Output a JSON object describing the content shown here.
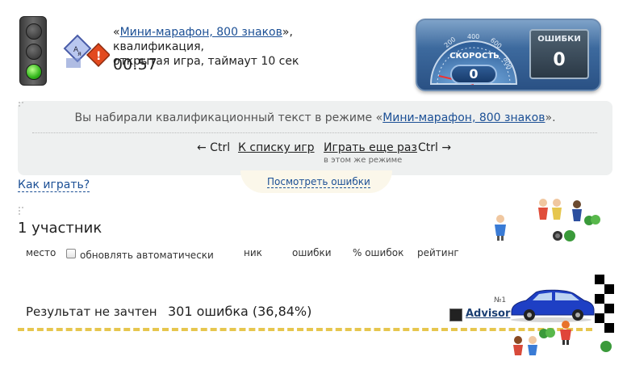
{
  "header": {
    "quote_open": "«",
    "mode_link": "Мини-марафон, 800 знаков",
    "quote_close_rest": "», квалификация,",
    "line2": "открытая игра, таймаут 10 сек",
    "timer": "00:57"
  },
  "dashboard": {
    "speed_label": "СКОРОСТЬ",
    "speed_value": "0",
    "errors_label": "ОШИБКИ",
    "errors_value": "0",
    "ticks": [
      "200",
      "400",
      "600",
      "800"
    ]
  },
  "panel": {
    "msg_prefix": "Вы набирали квалификационный текст в режиме «",
    "msg_link": "Мини-марафон, 800 знаков",
    "msg_suffix": "».",
    "left_hint": "← Ctrl",
    "back_link": "К списку игр",
    "again_link": "Играть еще раз",
    "right_hint": "Ctrl →",
    "again_note": "в этом же режиме"
  },
  "errors_link": "Посмотреть ошибки",
  "how_to_play": "Как играть?",
  "participants": "1 участник",
  "table_headers": {
    "place": "место",
    "auto_update": "обновлять автоматически",
    "nick": "ник",
    "errors": "ошибки",
    "error_pct": "% ошибок",
    "rating": "рейтинг"
  },
  "result": {
    "label": "Результат не зачтен",
    "errors": "301 ошибка (36,84%)",
    "place_no": "№1",
    "nick": "Advisor"
  },
  "colors": {
    "link": "#1b4f95",
    "track": "#e6c64e",
    "panel_bg": "#eef0f0",
    "car": "#1e3fc4"
  }
}
